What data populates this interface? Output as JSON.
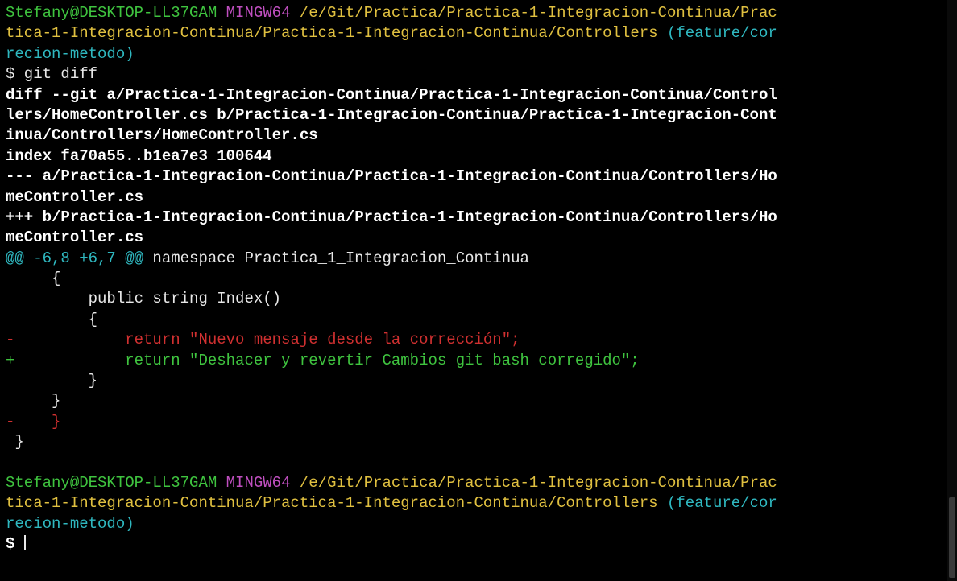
{
  "colors": {
    "green": "#3fc43f",
    "magenta": "#c04fc0",
    "yellow": "#e0c040",
    "cyan": "#2fb8c0",
    "red": "#d03030",
    "white": "#e8e8e8",
    "bold_white": "#ffffff"
  },
  "lines": [
    [
      {
        "t": "Stefany@DESKTOP-LL37GAM",
        "c": "green"
      },
      {
        "t": " ",
        "c": "white"
      },
      {
        "t": "MINGW64",
        "c": "magenta"
      },
      {
        "t": " ",
        "c": "white"
      },
      {
        "t": "/e/Git/Practica/Practica-1-Integracion-Continua/Prac",
        "c": "yellow"
      }
    ],
    [
      {
        "t": "tica-1-Integracion-Continua/Practica-1-Integracion-Continua/Controllers",
        "c": "yellow"
      },
      {
        "t": " ",
        "c": "white"
      },
      {
        "t": "(feature/cor",
        "c": "cyan"
      }
    ],
    [
      {
        "t": "recion-metodo)",
        "c": "cyan"
      }
    ],
    [
      {
        "t": "$ git diff",
        "c": "white"
      }
    ],
    [
      {
        "t": "diff --git a/Practica-1-Integracion-Continua/Practica-1-Integracion-Continua/Control",
        "c": "bold_white",
        "b": true
      }
    ],
    [
      {
        "t": "lers/HomeController.cs b/Practica-1-Integracion-Continua/Practica-1-Integracion-Cont",
        "c": "bold_white",
        "b": true
      }
    ],
    [
      {
        "t": "inua/Controllers/HomeController.cs",
        "c": "bold_white",
        "b": true
      }
    ],
    [
      {
        "t": "index fa70a55..b1ea7e3 100644",
        "c": "bold_white",
        "b": true
      }
    ],
    [
      {
        "t": "--- a/Practica-1-Integracion-Continua/Practica-1-Integracion-Continua/Controllers/Ho",
        "c": "bold_white",
        "b": true
      }
    ],
    [
      {
        "t": "meController.cs",
        "c": "bold_white",
        "b": true
      }
    ],
    [
      {
        "t": "+++ b/Practica-1-Integracion-Continua/Practica-1-Integracion-Continua/Controllers/Ho",
        "c": "bold_white",
        "b": true
      }
    ],
    [
      {
        "t": "meController.cs",
        "c": "bold_white",
        "b": true
      }
    ],
    [
      {
        "t": "@@ -6,8 +6,7 @@",
        "c": "cyan"
      },
      {
        "t": " namespace Practica_1_Integracion_Continua",
        "c": "white"
      }
    ],
    [
      {
        "t": "     {",
        "c": "white"
      }
    ],
    [
      {
        "t": "         public string Index()",
        "c": "white"
      }
    ],
    [
      {
        "t": "         {",
        "c": "white"
      }
    ],
    [
      {
        "t": "-            return \"Nuevo mensaje desde la corrección\";",
        "c": "red"
      }
    ],
    [
      {
        "t": "+            return \"Deshacer y revertir Cambios git bash corregido\";",
        "c": "green"
      }
    ],
    [
      {
        "t": "         }",
        "c": "white"
      }
    ],
    [
      {
        "t": "     }",
        "c": "white"
      }
    ],
    [
      {
        "t": "-    }",
        "c": "red"
      }
    ],
    [
      {
        "t": " }",
        "c": "white"
      }
    ],
    [
      {
        "t": "",
        "c": "white"
      }
    ],
    [
      {
        "t": "Stefany@DESKTOP-LL37GAM",
        "c": "green"
      },
      {
        "t": " ",
        "c": "white"
      },
      {
        "t": "MINGW64",
        "c": "magenta"
      },
      {
        "t": " ",
        "c": "white"
      },
      {
        "t": "/e/Git/Practica/Practica-1-Integracion-Continua/Prac",
        "c": "yellow"
      }
    ],
    [
      {
        "t": "tica-1-Integracion-Continua/Practica-1-Integracion-Continua/Controllers",
        "c": "yellow"
      },
      {
        "t": " ",
        "c": "white"
      },
      {
        "t": "(feature/cor",
        "c": "cyan"
      }
    ],
    [
      {
        "t": "recion-metodo)",
        "c": "cyan"
      }
    ],
    [
      {
        "t": "$ ",
        "c": "bold_white",
        "b": true
      }
    ]
  ]
}
